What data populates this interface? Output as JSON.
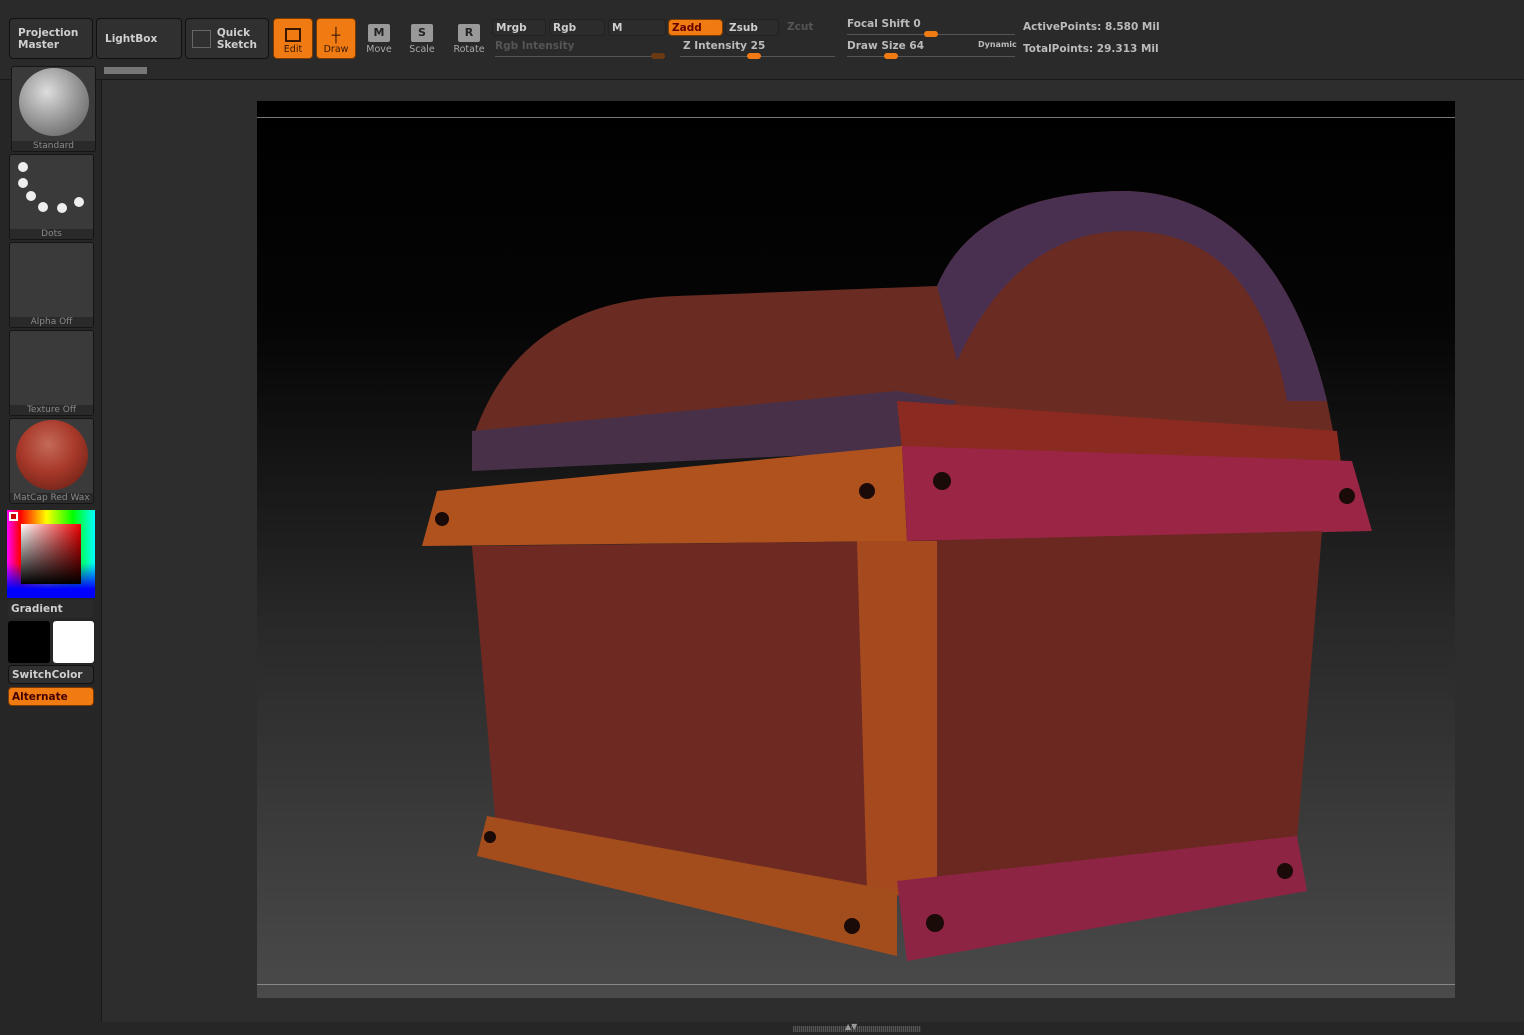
{
  "toolbar": {
    "projection_master": "Projection Master",
    "lightbox": "LightBox",
    "quick_sketch": "Quick Sketch",
    "edit": "Edit",
    "draw": "Draw",
    "move": "Move",
    "scale": "Scale",
    "rotate": "Rotate",
    "move_key": "M",
    "scale_key": "S",
    "rotate_key": "R",
    "mrgb": "Mrgb",
    "rgb": "Rgb",
    "m": "M",
    "zadd": "Zadd",
    "zsub": "Zsub",
    "zcut": "Zcut",
    "rgb_intensity": "Rgb Intensity",
    "z_intensity": "Z Intensity 25",
    "z_intensity_value": 25,
    "focal_shift": "Focal Shift 0",
    "focal_shift_value": 0,
    "draw_size": "Draw Size 64",
    "draw_size_value": 64,
    "dynamic": "Dynamic",
    "active_points": "ActivePoints: 8.580 Mil",
    "total_points": "TotalPoints: 29.313 Mil"
  },
  "left": {
    "brush": "Standard",
    "stroke": "Dots",
    "alpha": "Alpha Off",
    "texture": "Texture Off",
    "material": "MatCap Red Wax",
    "gradient": "Gradient",
    "switch_color": "SwitchColor",
    "alternate": "Alternate"
  },
  "colors": {
    "accent": "#f07b12",
    "main_color": "#000000",
    "secondary_color": "#ffffff",
    "material": "#a8392a"
  }
}
